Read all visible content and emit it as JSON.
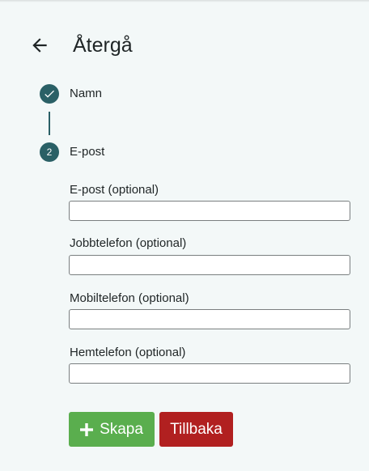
{
  "header": {
    "back_icon": "arrow-left-icon",
    "title": "Återgå"
  },
  "stepper": {
    "steps": [
      {
        "label": "Namn",
        "status": "completed",
        "icon": "check-icon"
      },
      {
        "label": "E-post",
        "status": "active",
        "number": "2"
      }
    ],
    "accent_color": "#2a6066"
  },
  "form": {
    "fields": [
      {
        "label": "E-post (optional)",
        "value": ""
      },
      {
        "label": "Jobbtelefon (optional)",
        "value": ""
      },
      {
        "label": "Mobiltelefon (optional)",
        "value": ""
      },
      {
        "label": "Hemtelefon (optional)",
        "value": ""
      }
    ]
  },
  "actions": {
    "create_label": "Skapa",
    "create_icon": "plus-icon",
    "create_color": "#5aae4e",
    "back_label": "Tillbaka",
    "back_color": "#b12020"
  }
}
